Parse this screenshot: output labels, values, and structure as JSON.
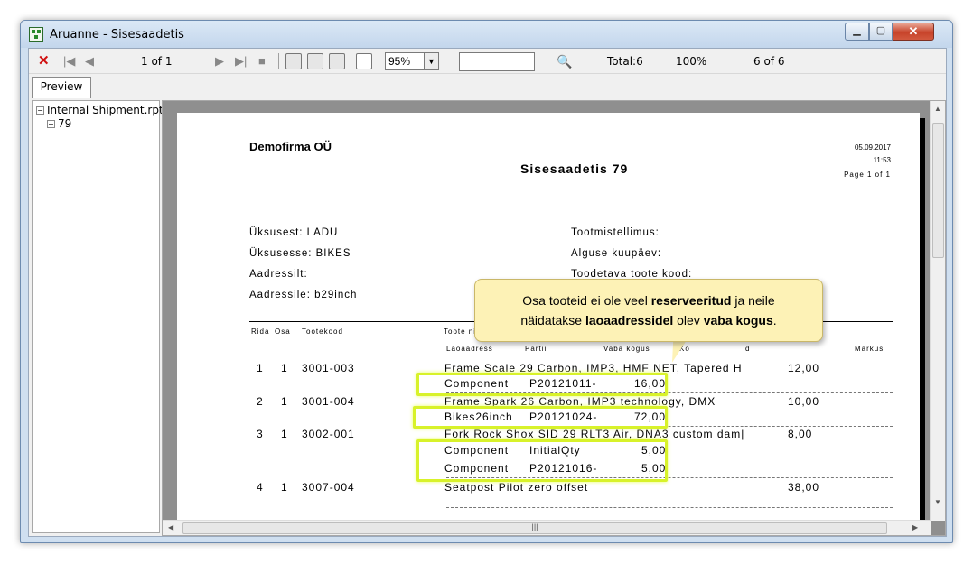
{
  "window": {
    "title": "Aruanne - Sisesaadetis"
  },
  "toolbar": {
    "page_indicator": "1 of 1",
    "zoom": "95%",
    "total": "Total:6",
    "percent": "100%",
    "count": "6 of 6"
  },
  "tabs": [
    {
      "label": "Preview"
    }
  ],
  "tree": {
    "root": "Internal Shipment.rpt",
    "child": "79"
  },
  "report": {
    "company": "Demofirma OÜ",
    "title": "Sisesaadetis  79",
    "date": "05.09.2017",
    "time": "11:53",
    "page": "Page 1 of 1",
    "from_unit": "Üksusest: LADU",
    "to_unit": "Üksusesse: BIKES",
    "from_address": "Aadressilt:",
    "to_address": "Aadressile: b29inch",
    "production_order": "Tootmistellimus:",
    "start_date": "Alguse kuupäev:",
    "product_code": "Toodetava toote kood:",
    "columns": {
      "row": "Rida",
      "part": "Osa",
      "code": "Tootekood",
      "name": "Toote nimi",
      "location": "Laoaadress",
      "batch": "Partii",
      "free_qty": "Vaba kogus",
      "qty_prefix": "Ko",
      "qty_suffix": "d",
      "note": "Märkus"
    },
    "rows": [
      {
        "row": "1",
        "part": "1",
        "code": "3001-003",
        "name": "Frame Scale 29 Carbon, IMP3, HMF NET, Tapered H",
        "qty": "12,00",
        "locations": [
          {
            "location": "Component",
            "batch": "P20121011-",
            "free_qty": "16,00"
          }
        ]
      },
      {
        "row": "2",
        "part": "1",
        "code": "3001-004",
        "name": "Frame Spark 26 Carbon, IMP3 technology, DMX",
        "qty": "10,00",
        "locations": [
          {
            "location": "Bikes26inch",
            "batch": "P20121024-",
            "free_qty": "72,00"
          }
        ]
      },
      {
        "row": "3",
        "part": "1",
        "code": "3002-001",
        "name": "Fork Rock Shox SID 29 RLT3 Air, DNA3 custom dam|",
        "qty": "8,00",
        "locations": [
          {
            "location": "Component",
            "batch": "InitialQty",
            "free_qty": "5,00"
          },
          {
            "location": "Component",
            "batch": "P20121016-",
            "free_qty": "5,00"
          }
        ]
      },
      {
        "row": "4",
        "part": "1",
        "code": "3007-004",
        "name": "Seatpost Pilot zero offset",
        "qty": "38,00",
        "locations": []
      }
    ]
  },
  "callout": {
    "part1": "Osa tooteid ei ole veel ",
    "bold1": "reserveeritud",
    "part2": " ja neile",
    "part3": "näidatakse ",
    "bold2": "laoaadressidel",
    "part4": " olev ",
    "bold3": "vaba kogus",
    "part5": "."
  },
  "icons": {
    "stop": "stop-icon",
    "first": "first-page-icon",
    "prev": "prev-page-icon",
    "next": "next-page-icon",
    "last": "last-page-icon",
    "print": "print-icon",
    "print_setup": "print-setup-icon",
    "export": "export-icon",
    "tree_toggle": "group-tree-icon",
    "search": "binoculars-icon"
  }
}
